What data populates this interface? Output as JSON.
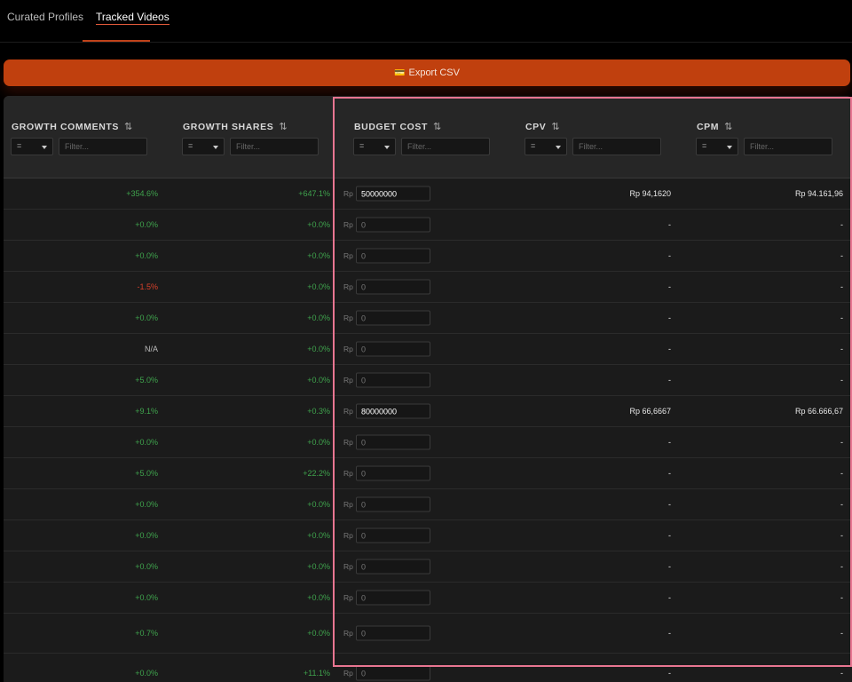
{
  "tabs": [
    {
      "label": "Curated Profiles"
    },
    {
      "label": "Tracked Videos"
    }
  ],
  "export_button": {
    "icon": "💳",
    "label": "Export CSV"
  },
  "columns": [
    {
      "title": "GROWTH COMMENTS",
      "sort_icon": "⇅",
      "op": "=",
      "placeholder": "Filter..."
    },
    {
      "title": "GROWTH SHARES",
      "sort_icon": "⇅",
      "op": "=",
      "placeholder": "Filter..."
    },
    {
      "title": "BUDGET COST",
      "sort_icon": "⇅",
      "op": "=",
      "placeholder": "Filter..."
    },
    {
      "title": "CPV",
      "sort_icon": "⇅",
      "op": "=",
      "placeholder": "Filter..."
    },
    {
      "title": "CPM",
      "sort_icon": "⇅",
      "op": "=",
      "placeholder": "Filter..."
    }
  ],
  "currency_prefix": "Rp",
  "rows": [
    {
      "gc": "+354.6%",
      "gcs": "pos",
      "gs": "+647.1%",
      "gss": "pos",
      "budget": "50000000",
      "cpv": "Rp 94,1620",
      "cpm": "Rp 94.161,96"
    },
    {
      "gc": "+0.0%",
      "gcs": "pos",
      "gs": "+0.0%",
      "gss": "pos",
      "budget": "0",
      "cpv": "-",
      "cpm": "-"
    },
    {
      "gc": "+0.0%",
      "gcs": "pos",
      "gs": "+0.0%",
      "gss": "pos",
      "budget": "0",
      "cpv": "-",
      "cpm": "-"
    },
    {
      "gc": "-1.5%",
      "gcs": "neg",
      "gs": "+0.0%",
      "gss": "pos",
      "budget": "0",
      "cpv": "-",
      "cpm": "-"
    },
    {
      "gc": "+0.0%",
      "gcs": "pos",
      "gs": "+0.0%",
      "gss": "pos",
      "budget": "0",
      "cpv": "-",
      "cpm": "-"
    },
    {
      "gc": "N/A",
      "gcs": "na",
      "gs": "+0.0%",
      "gss": "pos",
      "budget": "0",
      "cpv": "-",
      "cpm": "-"
    },
    {
      "gc": "+5.0%",
      "gcs": "pos",
      "gs": "+0.0%",
      "gss": "pos",
      "budget": "0",
      "cpv": "-",
      "cpm": "-"
    },
    {
      "gc": "+9.1%",
      "gcs": "pos",
      "gs": "+0.3%",
      "gss": "pos",
      "budget": "80000000",
      "cpv": "Rp 66,6667",
      "cpm": "Rp 66.666,67"
    },
    {
      "gc": "+0.0%",
      "gcs": "pos",
      "gs": "+0.0%",
      "gss": "pos",
      "budget": "0",
      "cpv": "-",
      "cpm": "-"
    },
    {
      "gc": "+5.0%",
      "gcs": "pos",
      "gs": "+22.2%",
      "gss": "pos",
      "budget": "0",
      "cpv": "-",
      "cpm": "-"
    },
    {
      "gc": "+0.0%",
      "gcs": "pos",
      "gs": "+0.0%",
      "gss": "pos",
      "budget": "0",
      "cpv": "-",
      "cpm": "-"
    },
    {
      "gc": "+0.0%",
      "gcs": "pos",
      "gs": "+0.0%",
      "gss": "pos",
      "budget": "0",
      "cpv": "-",
      "cpm": "-"
    },
    {
      "gc": "+0.0%",
      "gcs": "pos",
      "gs": "+0.0%",
      "gss": "pos",
      "budget": "0",
      "cpv": "-",
      "cpm": "-"
    },
    {
      "gc": "+0.0%",
      "gcs": "pos",
      "gs": "+0.0%",
      "gss": "pos",
      "budget": "0",
      "cpv": "-",
      "cpm": "-"
    },
    {
      "gc": "+0.7%",
      "gcs": "pos",
      "gs": "+0.0%",
      "gss": "pos",
      "budget": "0",
      "cpv": "-",
      "cpm": "-"
    },
    {
      "gc": "+0.0%",
      "gcs": "pos",
      "gs": "+11.1%",
      "gss": "pos",
      "budget": "0",
      "cpv": "-",
      "cpm": "-"
    }
  ],
  "colors": {
    "accent": "#c0400e",
    "positive": "#3fa34d",
    "negative": "#d9412b",
    "highlight": "#e87591"
  }
}
